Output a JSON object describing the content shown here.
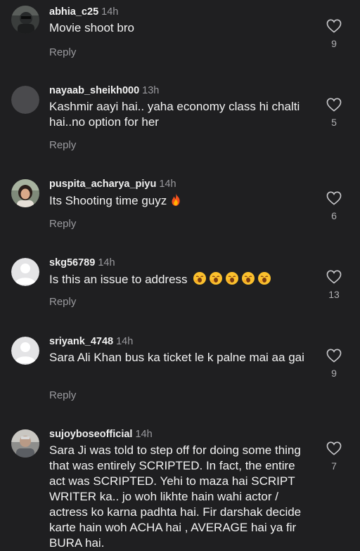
{
  "colors": {
    "background": "#1f1f21",
    "secondary_text": "#9a9a9e",
    "primary_text": "#f2f2f2"
  },
  "comments": [
    {
      "username": "abhia_c25",
      "time": "14h",
      "text": "Movie shoot bro",
      "reply_label": "Reply",
      "likes": "9",
      "avatar": "photo-dark-person"
    },
    {
      "username": "nayaab_sheikh000",
      "time": "13h",
      "text": "Kashmir aayi hai.. yaha economy class hi chalti hai..no option for her",
      "reply_label": "Reply",
      "likes": "5",
      "avatar": "plain-grey-circle"
    },
    {
      "username": "puspita_acharya_piyu",
      "time": "14h",
      "text": "Its Shooting time guyz",
      "emoji": "fire-emoji",
      "reply_label": "Reply",
      "likes": "6",
      "avatar": "photo-woman-portrait"
    },
    {
      "username": "skg56789",
      "time": "14h",
      "text": "Is this an issue to address",
      "emoji": "yawning-face-emoji x5",
      "reply_label": "Reply",
      "likes": "13",
      "avatar": "default-person-icon"
    },
    {
      "username": "sriyank_4748",
      "time": "14h",
      "text": "Sara Ali Khan bus ka ticket le k palne mai aa gai",
      "reply_label": "Reply",
      "likes": "9",
      "avatar": "default-person-icon"
    },
    {
      "username": "sujoyboseofficial",
      "time": "14h",
      "text": "Sara Ji was told to step off for doing some thing that was entirely SCRIPTED. In fact, the entire act was SCRIPTED.  Yehi to maza hai SCRIPT WRITER ka.. jo woh likhte hain wahi actor / actress ko karna padhta hai. Fir darshak decide karte hain woh ACHA hai , AVERAGE hai ya fir BURA hai.",
      "likes": "7",
      "avatar": "photo-man-grey"
    }
  ]
}
